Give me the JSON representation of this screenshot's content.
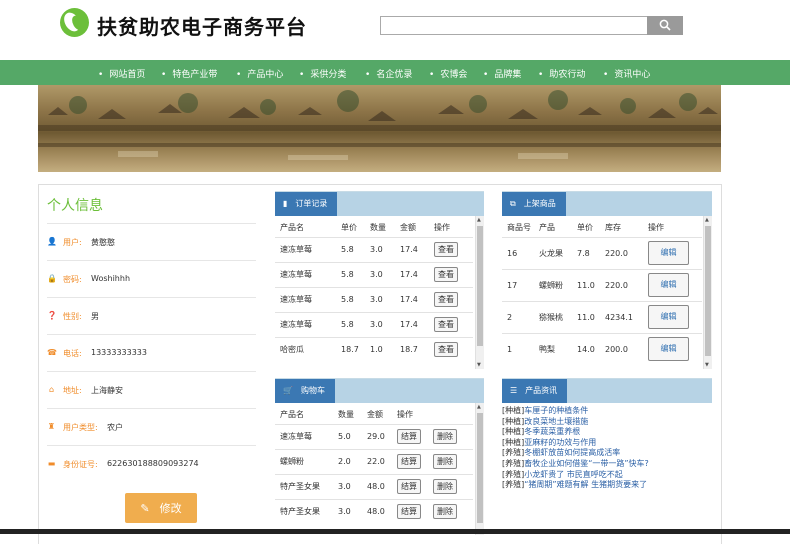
{
  "header": {
    "title": "扶贫助农电子商务平台",
    "search_placeholder": "",
    "search_icon": "search-icon"
  },
  "nav": [
    "网站首页",
    "特色产业带",
    "产品中心",
    "采供分类",
    "名企优录",
    "农博会",
    "品牌集",
    "助农行动",
    "资讯中心"
  ],
  "profile": {
    "title": "个人信息",
    "rows": [
      {
        "label": "用户:",
        "value": "黄憨憨",
        "icon": "user-icon"
      },
      {
        "label": "密码:",
        "value": "Woshihhh",
        "icon": "lock-icon"
      },
      {
        "label": "性别:",
        "value": "男",
        "icon": "question-icon"
      },
      {
        "label": "电话:",
        "value": "13333333333",
        "icon": "phone-icon"
      },
      {
        "label": "地址:",
        "value": "上海静安",
        "icon": "home-icon"
      },
      {
        "label": "用户类型:",
        "value": "农户",
        "icon": "user-type-icon"
      },
      {
        "label": "身份证号:",
        "value": "622630188809093274",
        "icon": "id-card-icon"
      }
    ],
    "edit_label": "修改"
  },
  "orders": {
    "tab_label": "订单记录",
    "headers": [
      "产品名",
      "单价",
      "数量",
      "金额",
      "操作"
    ],
    "rows": [
      {
        "name": "速冻草莓",
        "price": "5.8",
        "qty": "3.0",
        "amount": "17.4",
        "action": "查看"
      },
      {
        "name": "速冻草莓",
        "price": "5.8",
        "qty": "3.0",
        "amount": "17.4",
        "action": "查看"
      },
      {
        "name": "速冻草莓",
        "price": "5.8",
        "qty": "3.0",
        "amount": "17.4",
        "action": "查看"
      },
      {
        "name": "速冻草莓",
        "price": "5.8",
        "qty": "3.0",
        "amount": "17.4",
        "action": "查看"
      },
      {
        "name": "哈密瓜",
        "price": "18.7",
        "qty": "1.0",
        "amount": "18.7",
        "action": "查看"
      }
    ]
  },
  "products": {
    "tab_label": "上架商品",
    "headers": [
      "商品号",
      "产品",
      "单价",
      "库存",
      "操作"
    ],
    "rows": [
      {
        "id": "16",
        "name": "火龙果",
        "price": "7.8",
        "stock": "220.0",
        "action": "编辑"
      },
      {
        "id": "17",
        "name": "螺蛳粉",
        "price": "11.0",
        "stock": "220.0",
        "action": "编辑"
      },
      {
        "id": "2",
        "name": "猕猴桃",
        "price": "11.0",
        "stock": "4234.1",
        "action": "编辑"
      },
      {
        "id": "1",
        "name": "鸭梨",
        "price": "14.0",
        "stock": "200.0",
        "action": "编辑"
      }
    ]
  },
  "cart": {
    "tab_label": "购物车",
    "headers": [
      "产品名",
      "数量",
      "金额",
      "操作"
    ],
    "rows": [
      {
        "name": "速冻草莓",
        "qty": "5.0",
        "amount": "29.0",
        "settle": "结算",
        "delete": "删除"
      },
      {
        "name": "螺蛳粉",
        "qty": "2.0",
        "amount": "22.0",
        "settle": "结算",
        "delete": "删除"
      },
      {
        "name": "特产圣女果",
        "qty": "3.0",
        "amount": "48.0",
        "settle": "结算",
        "delete": "删除"
      },
      {
        "name": "特产圣女果",
        "qty": "3.0",
        "amount": "48.0",
        "settle": "结算",
        "delete": "删除"
      }
    ]
  },
  "news": {
    "tab_label": "产品资讯",
    "items": [
      {
        "cat": "[种植]",
        "title": "车厘子的种植条件"
      },
      {
        "cat": "[种植]",
        "title": "改良菜地土壤措施"
      },
      {
        "cat": "[种植]",
        "title": "冬季蔬菜重养根"
      },
      {
        "cat": "[种植]",
        "title": "亚麻籽的功效与作用"
      },
      {
        "cat": "[养殖]",
        "title": "冬棚虾放苗如何提高成活率"
      },
      {
        "cat": "[养殖]",
        "title": "畜牧企业如何借鉴“一带一路”快车?"
      },
      {
        "cat": "[养殖]",
        "title": "小龙虾贵了 市民直呼吃不起"
      },
      {
        "cat": "[养殖]",
        "title": "“猪周期”难题有解 生猪期货要来了"
      }
    ]
  },
  "colors": {
    "nav": "#55a867",
    "accent": "#6cbf3a",
    "label": "#f08c2a",
    "tab": "#3b78b3",
    "tab_bar": "#b7d3e5",
    "edit": "#f0ad4e"
  }
}
